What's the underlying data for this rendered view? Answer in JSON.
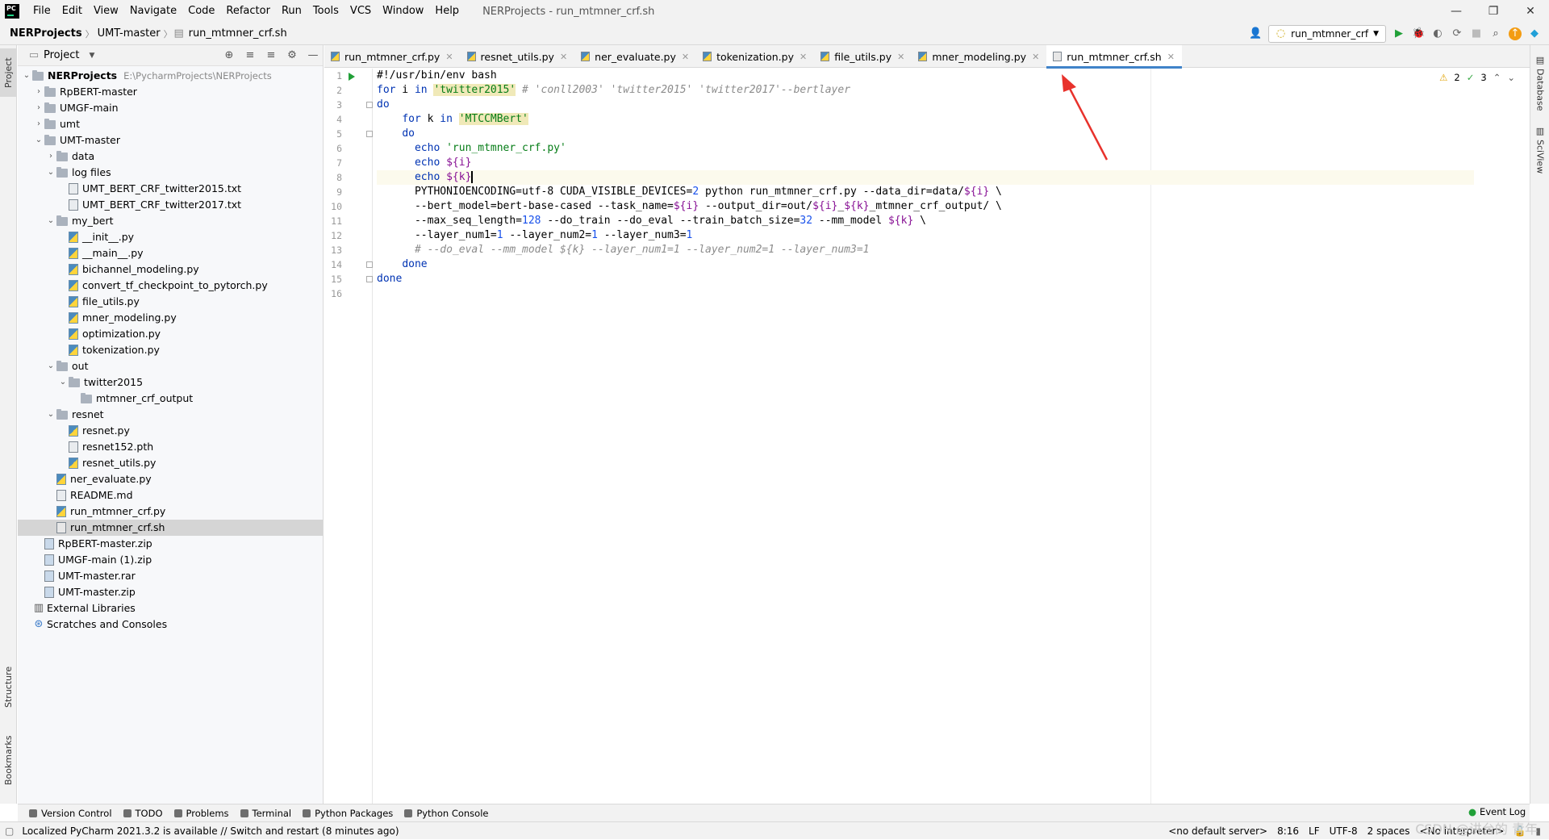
{
  "window": {
    "title": "NERProjects - run_mtmner_crf.sh",
    "menu": [
      "File",
      "Edit",
      "View",
      "Navigate",
      "Code",
      "Refactor",
      "Run",
      "Tools",
      "VCS",
      "Window",
      "Help"
    ]
  },
  "breadcrumb": [
    "NERProjects",
    "UMT-master",
    "run_mtmner_crf.sh"
  ],
  "toolbar": {
    "run_config": "run_mtmner_crf"
  },
  "project_panel": {
    "title": "Project",
    "tree": [
      {
        "label": "NERProjects",
        "path": "E:\\PycharmProjects\\NERProjects",
        "depth": 0,
        "type": "folder",
        "open": true,
        "bold": true
      },
      {
        "label": "RpBERT-master",
        "depth": 1,
        "type": "folder",
        "open": false
      },
      {
        "label": "UMGF-main",
        "depth": 1,
        "type": "folder",
        "open": false
      },
      {
        "label": "umt",
        "depth": 1,
        "type": "folder",
        "open": false
      },
      {
        "label": "UMT-master",
        "depth": 1,
        "type": "folder",
        "open": true
      },
      {
        "label": "data",
        "depth": 2,
        "type": "folder",
        "open": false
      },
      {
        "label": "log files",
        "depth": 2,
        "type": "folder",
        "open": true
      },
      {
        "label": "UMT_BERT_CRF_twitter2015.txt",
        "depth": 3,
        "type": "txt"
      },
      {
        "label": "UMT_BERT_CRF_twitter2017.txt",
        "depth": 3,
        "type": "txt"
      },
      {
        "label": "my_bert",
        "depth": 2,
        "type": "folder",
        "open": true
      },
      {
        "label": "__init__.py",
        "depth": 3,
        "type": "py"
      },
      {
        "label": "__main__.py",
        "depth": 3,
        "type": "py"
      },
      {
        "label": "bichannel_modeling.py",
        "depth": 3,
        "type": "py"
      },
      {
        "label": "convert_tf_checkpoint_to_pytorch.py",
        "depth": 3,
        "type": "py"
      },
      {
        "label": "file_utils.py",
        "depth": 3,
        "type": "py"
      },
      {
        "label": "mner_modeling.py",
        "depth": 3,
        "type": "py"
      },
      {
        "label": "optimization.py",
        "depth": 3,
        "type": "py"
      },
      {
        "label": "tokenization.py",
        "depth": 3,
        "type": "py"
      },
      {
        "label": "out",
        "depth": 2,
        "type": "folder",
        "open": true
      },
      {
        "label": "twitter2015",
        "depth": 3,
        "type": "folder",
        "open": true
      },
      {
        "label": "mtmner_crf_output",
        "depth": 4,
        "type": "folder",
        "leaf": true
      },
      {
        "label": "resnet",
        "depth": 2,
        "type": "folder",
        "open": true
      },
      {
        "label": "resnet.py",
        "depth": 3,
        "type": "py"
      },
      {
        "label": "resnet152.pth",
        "depth": 3,
        "type": "txt"
      },
      {
        "label": "resnet_utils.py",
        "depth": 3,
        "type": "py"
      },
      {
        "label": "ner_evaluate.py",
        "depth": 2,
        "type": "py"
      },
      {
        "label": "README.md",
        "depth": 2,
        "type": "txt"
      },
      {
        "label": "run_mtmner_crf.py",
        "depth": 2,
        "type": "py"
      },
      {
        "label": "run_mtmner_crf.sh",
        "depth": 2,
        "type": "sh",
        "selected": true
      },
      {
        "label": "RpBERT-master.zip",
        "depth": 1,
        "type": "zip"
      },
      {
        "label": "UMGF-main (1).zip",
        "depth": 1,
        "type": "zip"
      },
      {
        "label": "UMT-master.rar",
        "depth": 1,
        "type": "zip"
      },
      {
        "label": "UMT-master.zip",
        "depth": 1,
        "type": "zip"
      },
      {
        "label": "External Libraries",
        "depth": 0,
        "type": "lib",
        "leaf": true
      },
      {
        "label": "Scratches and Consoles",
        "depth": 0,
        "type": "scratch",
        "leaf": true
      }
    ]
  },
  "tabs": [
    {
      "label": "run_mtmner_crf.py",
      "type": "py"
    },
    {
      "label": "resnet_utils.py",
      "type": "py"
    },
    {
      "label": "ner_evaluate.py",
      "type": "py"
    },
    {
      "label": "tokenization.py",
      "type": "py"
    },
    {
      "label": "file_utils.py",
      "type": "py"
    },
    {
      "label": "mner_modeling.py",
      "type": "py"
    },
    {
      "label": "run_mtmner_crf.sh",
      "type": "sh",
      "active": true
    }
  ],
  "inspections": {
    "warnings": "2",
    "ok": "3"
  },
  "code_lines": [
    "#!/usr/bin/env bash",
    "for i in 'twitter2015' # 'conll2003' 'twitter2015' 'twitter2017'--bertlayer",
    "do",
    "    for k in 'MTCCMBert'",
    "    do",
    "      echo 'run_mtmner_crf.py'",
    "      echo ${i}",
    "      echo ${k}",
    "      PYTHONIOENCODING=utf-8 CUDA_VISIBLE_DEVICES=2 python run_mtmner_crf.py --data_dir=data/${i} \\",
    "      --bert_model=bert-base-cased --task_name=${i} --output_dir=out/${i}_${k}_mtmner_crf_output/ \\",
    "      --max_seq_length=128 --do_train --do_eval --train_batch_size=32 --mm_model ${k} \\",
    "      --layer_num1=1 --layer_num2=1 --layer_num3=1",
    "      # --do_eval --mm_model ${k} --layer_num1=1 --layer_num2=1 --layer_num3=1",
    "    done",
    "done",
    ""
  ],
  "left_strip": {
    "project": "Project",
    "structure": "Structure",
    "bookmarks": "Bookmarks"
  },
  "right_strip": {
    "database": "Database",
    "sciview": "SciView"
  },
  "bottom_tools": [
    "Version Control",
    "TODO",
    "Problems",
    "Terminal",
    "Python Packages",
    "Python Console"
  ],
  "event_log": "Event Log",
  "status": {
    "message": "Localized PyCharm 2021.3.2 is available // Switch and restart (8 minutes ago)",
    "server": "<no default server>",
    "position": "8:16",
    "line_sep": "LF",
    "encoding": "UTF-8",
    "indent": "2 spaces",
    "interpreter": "<No interpreter>"
  },
  "watermark": "CSDN @讲台的 青年",
  "colors": {
    "accent": "#4083c9",
    "annotation_arrow": "#e8322c",
    "keyword": "#0033b3",
    "string": "#067d17"
  }
}
